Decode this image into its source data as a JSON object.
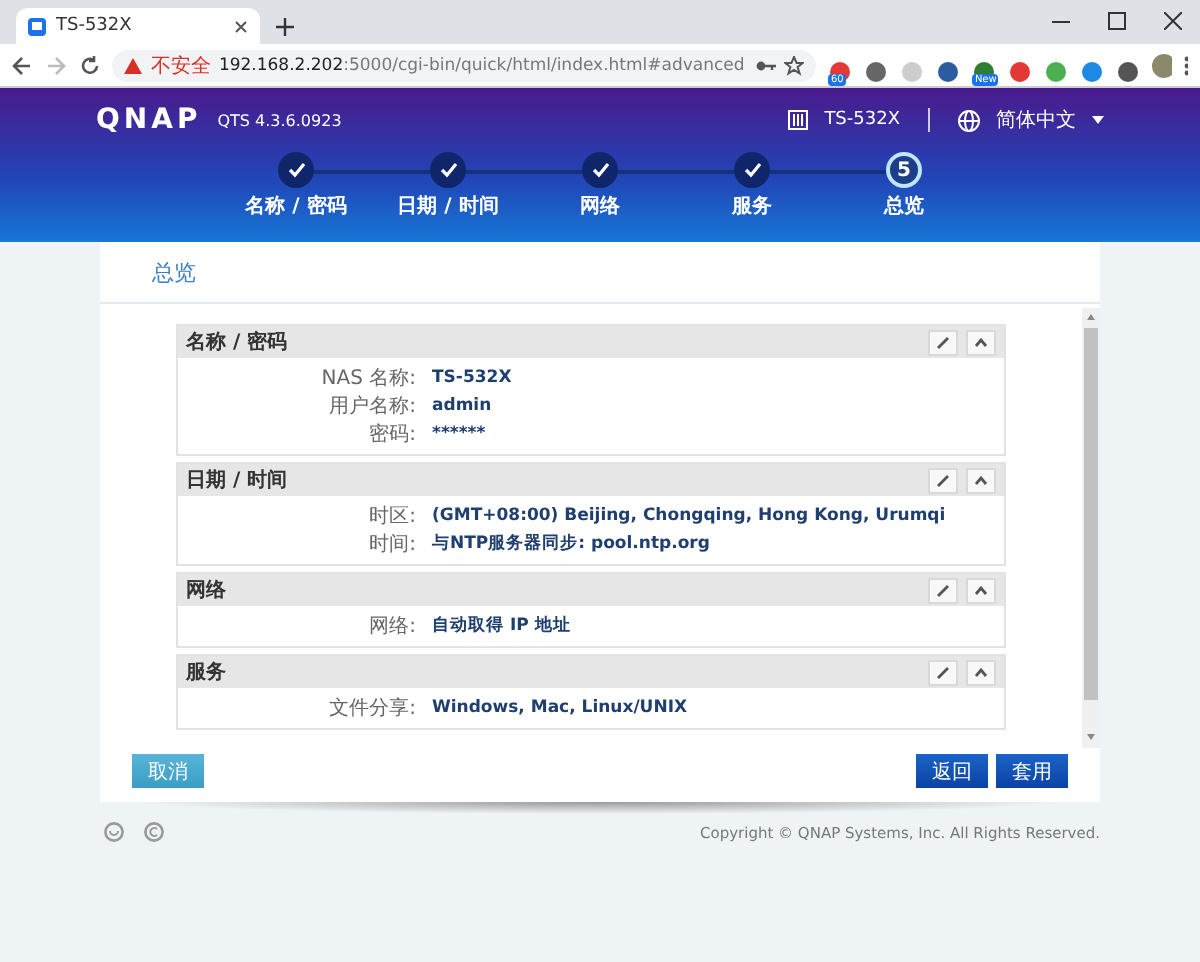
{
  "browser": {
    "tab": {
      "title": "TS-532X"
    },
    "security": "不安全",
    "url_host": "192.168.2.202",
    "url_rest": ":5000/cgi-bin/quick/html/index.html#advanced",
    "extension_badges": [
      "60",
      "New"
    ]
  },
  "header": {
    "logo": "QNAP",
    "version": "QTS 4.3.6.0923",
    "device": "TS-532X",
    "language": "简体中文"
  },
  "steps": [
    {
      "label": "名称 / 密码",
      "done": true
    },
    {
      "label": "日期 / 时间",
      "done": true
    },
    {
      "label": "网络",
      "done": true
    },
    {
      "label": "服务",
      "done": true
    },
    {
      "label": "总览",
      "done": false,
      "number": "5"
    }
  ],
  "panel": {
    "title": "总览",
    "sections": [
      {
        "title": "名称 / 密码",
        "expanded": true,
        "rows": [
          {
            "label": "NAS 名称:",
            "value": "TS-532X"
          },
          {
            "label": "用户名称:",
            "value": "admin"
          },
          {
            "label": "密码:",
            "value": "******"
          }
        ]
      },
      {
        "title": "日期 / 时间",
        "expanded": true,
        "rows": [
          {
            "label": "时区:",
            "value": "(GMT+08:00) Beijing, Chongqing, Hong Kong, Urumqi"
          },
          {
            "label": "时间:",
            "value": "与NTP服务器同步:  pool.ntp.org"
          }
        ]
      },
      {
        "title": "网络",
        "expanded": true,
        "rows": [
          {
            "label": "网络:",
            "value": "自动取得 IP 地址"
          }
        ]
      },
      {
        "title": "服务",
        "expanded": true,
        "rows": [
          {
            "label": "文件分享:",
            "value": "Windows, Mac, Linux/UNIX"
          }
        ]
      }
    ],
    "buttons": [
      {
        "label": "取消",
        "kind": "secondary"
      },
      {
        "label": "返回",
        "kind": "primary"
      },
      {
        "label": "套用",
        "kind": "primary"
      }
    ]
  },
  "footer": {
    "copyright": "Copyright © QNAP Systems, Inc. All Rights Reserved."
  }
}
